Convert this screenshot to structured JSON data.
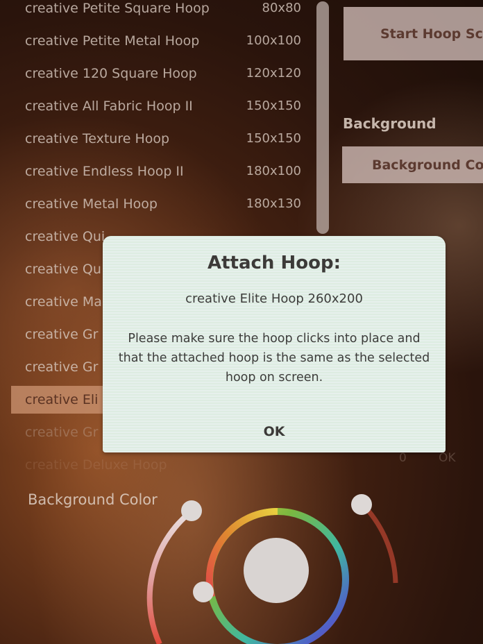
{
  "hoop_list": [
    {
      "name": "creative Petite Square Hoop",
      "size": "80x80"
    },
    {
      "name": "creative Petite Metal Hoop",
      "size": "100x100"
    },
    {
      "name": "creative 120 Square Hoop",
      "size": "120x120"
    },
    {
      "name": "creative All Fabric Hoop II",
      "size": "150x150"
    },
    {
      "name": "creative Texture Hoop",
      "size": "150x150"
    },
    {
      "name": "creative Endless Hoop II",
      "size": "180x100"
    },
    {
      "name": "creative Metal Hoop",
      "size": "180x130"
    },
    {
      "name": "creative Qui",
      "size": ""
    },
    {
      "name": "creative Qu",
      "size": ""
    },
    {
      "name": "creative Ma",
      "size": ""
    },
    {
      "name": "creative Gr",
      "size": ""
    },
    {
      "name": "creative Gr",
      "size": ""
    },
    {
      "name": "creative Eli",
      "size": "",
      "selected": true
    },
    {
      "name": "creative Gr",
      "size": ""
    },
    {
      "name": "creative Deluxe Hoop",
      "size": ""
    }
  ],
  "side_panel": {
    "start_scan_label": "Start Hoop Sca",
    "background_heading": "Background",
    "background_color_button": "Background Co"
  },
  "background_color_section": {
    "label": "Background Color",
    "ghost_values": [
      "0",
      "OK"
    ]
  },
  "modal": {
    "title": "Attach Hoop:",
    "hoop": "creative Elite Hoop  260x200",
    "message": "Please make sure the hoop clicks into place and that the attached hoop is the same as the selected hoop on screen.",
    "ok_label": "OK"
  },
  "colors": {
    "modal_bg": "#e6f0ec",
    "selected_row": "#cd9673",
    "button_bg": "#d2beb9"
  }
}
